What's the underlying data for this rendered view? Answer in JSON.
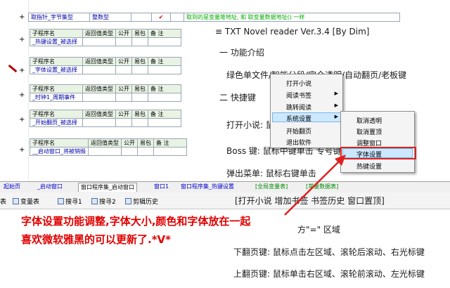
{
  "top_row": {
    "col1": "取指针_字节集型",
    "col2": "整数型",
    "col3": "",
    "check": "✔",
    "comment": "取到的是变量堆地址, 和 取变量数据地址() 一样"
  },
  "table_headers": {
    "name": "子程序名",
    "ret": "返回值类型",
    "pub": "公开",
    "easy": "易包",
    "note": "备 注"
  },
  "subs": [
    "_热键设置_被选择",
    "_字体设置_被选择",
    "_时钟1_周期事件",
    "_开始翻页_被选择",
    "__启动窗口_将被销毁"
  ],
  "reader": {
    "title": "≡  TXT Novel reader  Ver.3.4 [By Dim]",
    "section1": "一 功能介绍",
    "line1": "绿色单文件/智能分段/完全透明/自动翻页/老板键",
    "section2": "二 快捷键",
    "line2": "打开小说: 鼠",
    "line3": "Boss 键: 鼠标中键单击 专号键",
    "line4": "弹出菜单: 鼠标右键单击"
  },
  "menu1": [
    "打开小说",
    "阅读书签",
    "跳转阅读",
    "系统设置",
    "开始翻页",
    "退出软件"
  ],
  "menu2": [
    "取消透明",
    "取消置顶",
    "调整窗口",
    "字体设置",
    "热键设置"
  ],
  "tabs": [
    "起始页",
    "_启动窗口",
    "窗口程序集_启动窗口",
    "窗口1",
    "窗口程序集_热键设置",
    "[全局变量表]",
    "[常量数据表]"
  ],
  "toolbar": [
    "表",
    "变量表",
    "搜寻1",
    "搜寻2",
    "剪辑历史"
  ],
  "bottom_reader": {
    "menu_line": "[打开小说 增加书签 书签历史 窗口置顶]",
    "region": "方\"=\" 区域",
    "next": "下翻页键: 鼠标点击左区域、滚轮后滚动、右光标键",
    "prev": "上翻页键: 鼠标单击右区域、滚轮前滚动、左光标键"
  },
  "caption": {
    "line1": "字体设置功能调整,字体大小,颜色和字体放在一起",
    "line2": "喜欢微软雅黑的可以更新了.*V*"
  },
  "colors": {
    "red": "#e00000",
    "highlight": "#cce8ff"
  }
}
